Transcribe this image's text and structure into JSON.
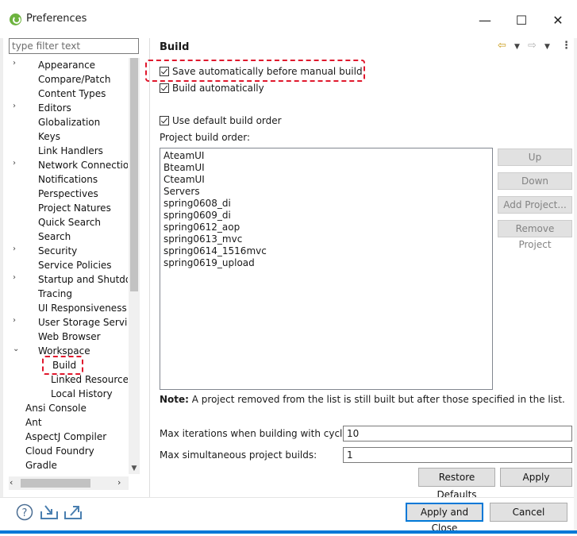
{
  "window": {
    "title": "Preferences",
    "minimize": "—",
    "maximize": "☐",
    "close": "✕"
  },
  "filter": {
    "placeholder": "type filter text"
  },
  "tree": [
    {
      "label": "Appearance",
      "expander": "›",
      "level": 2
    },
    {
      "label": "Compare/Patch",
      "expander": "",
      "level": 2
    },
    {
      "label": "Content Types",
      "expander": "",
      "level": 2
    },
    {
      "label": "Editors",
      "expander": "›",
      "level": 2
    },
    {
      "label": "Globalization",
      "expander": "",
      "level": 2
    },
    {
      "label": "Keys",
      "expander": "",
      "level": 2
    },
    {
      "label": "Link Handlers",
      "expander": "",
      "level": 2
    },
    {
      "label": "Network Connection",
      "expander": "›",
      "level": 2
    },
    {
      "label": "Notifications",
      "expander": "",
      "level": 2
    },
    {
      "label": "Perspectives",
      "expander": "",
      "level": 2
    },
    {
      "label": "Project Natures",
      "expander": "",
      "level": 2
    },
    {
      "label": "Quick Search",
      "expander": "",
      "level": 2
    },
    {
      "label": "Search",
      "expander": "",
      "level": 2
    },
    {
      "label": "Security",
      "expander": "›",
      "level": 2
    },
    {
      "label": "Service Policies",
      "expander": "",
      "level": 2
    },
    {
      "label": "Startup and Shutdow",
      "expander": "›",
      "level": 2
    },
    {
      "label": "Tracing",
      "expander": "",
      "level": 2
    },
    {
      "label": "UI Responsiveness M",
      "expander": "",
      "level": 2
    },
    {
      "label": "User Storage Service",
      "expander": "›",
      "level": 2
    },
    {
      "label": "Web Browser",
      "expander": "",
      "level": 2
    },
    {
      "label": "Workspace",
      "expander": "⌄",
      "level": 2
    },
    {
      "label": "Build",
      "expander": "",
      "level": 3,
      "selected": true
    },
    {
      "label": "Linked Resources",
      "expander": "",
      "level": 3
    },
    {
      "label": "Local History",
      "expander": "",
      "level": 3
    },
    {
      "label": "Ansi Console",
      "expander": "",
      "level": 1
    },
    {
      "label": "Ant",
      "expander": "›",
      "level": 1
    },
    {
      "label": "AspectJ Compiler",
      "expander": "",
      "level": 1
    },
    {
      "label": "Cloud Foundry",
      "expander": "›",
      "level": 1
    },
    {
      "label": "Gradle",
      "expander": "",
      "level": 1
    }
  ],
  "page": {
    "title": "Build",
    "options": {
      "save_auto": "Save automatically before manual build",
      "build_auto": "Build automatically",
      "default_order": "Use default build order"
    },
    "build_order_label": "Project build order:",
    "projects": [
      "AteamUI",
      "BteamUI",
      "CteamUI",
      "Servers",
      "spring0608_di",
      "spring0609_di",
      "spring0612_aop",
      "spring0613_mvc",
      "spring0614_1516mvc",
      "spring0619_upload"
    ],
    "side_buttons": {
      "up": "Up",
      "down": "Down",
      "add": "Add Project...",
      "remove": "Remove Project"
    },
    "note_bold": "Note:",
    "note_text": " A project removed from the list is still built but after those specified in the list.",
    "max_iter_label": "Max iterations when building with cycles:",
    "max_iter_value": "10",
    "max_sim_label": "Max simultaneous project builds:",
    "max_sim_value": "1",
    "restore_defaults": "Restore Defaults",
    "apply": "Apply"
  },
  "footer": {
    "apply_close": "Apply and Close",
    "cancel": "Cancel"
  },
  "colors": {
    "annotation": "#e0182d",
    "nav_arrow": "#c99a17",
    "default_button_border": "#0078d7"
  }
}
